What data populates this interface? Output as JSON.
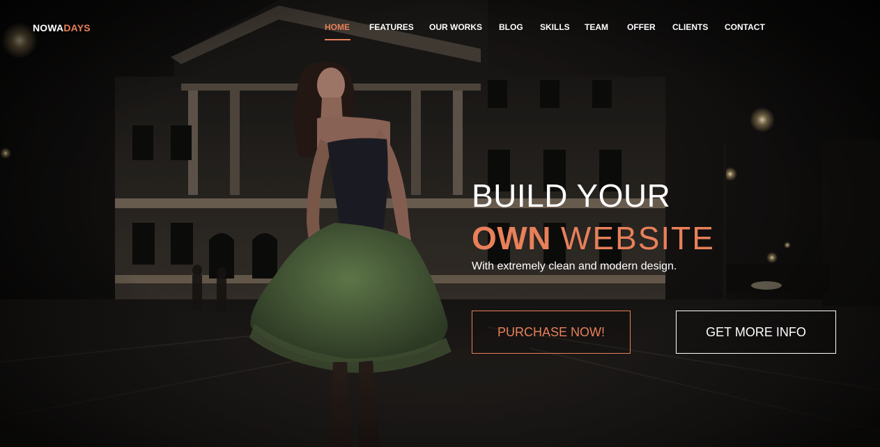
{
  "logo": {
    "part1": "NOWA",
    "part2": "DAYS"
  },
  "nav": {
    "home": "HOME",
    "features": "FEATURES",
    "our_works": "OUR WORKS",
    "blog": "BLOG",
    "skills": "SKILLS",
    "team": "TEAM",
    "offer": "OFFER",
    "clients": "CLIENTS",
    "contact": "CONTACT"
  },
  "hero": {
    "line1": "BUILD YOUR",
    "line2_strong": "OWN",
    "line2_light": "WEBSITE",
    "subtitle": "With extremely clean and modern design.",
    "primary_button": "PURCHASE NOW!",
    "secondary_button": "GET MORE INFO"
  },
  "colors": {
    "accent": "#e8805a",
    "text": "#ffffff",
    "background": "#0b0b0c"
  }
}
